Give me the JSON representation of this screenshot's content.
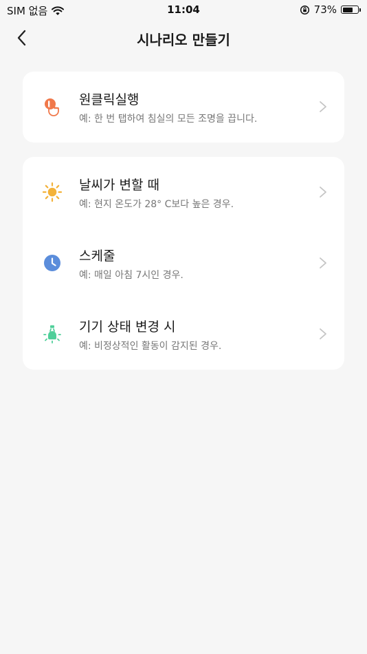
{
  "status_bar": {
    "carrier": "SIM 없음",
    "time": "11:04",
    "battery_percent": "73%",
    "battery_level": 0.73
  },
  "header": {
    "title": "시나리오 만들기",
    "back_icon": "chevron-left-icon"
  },
  "sections": [
    {
      "items": [
        {
          "title": "원클릭실행",
          "description": "예: 한 번 탭하여 침실의 모든 조명을 끕니다.",
          "icon": "tap-hand-icon",
          "icon_color": "#f0784a"
        }
      ]
    },
    {
      "items": [
        {
          "title": "날씨가 변할 때",
          "description": "예: 현지 온도가 28° C보다 높은 경우.",
          "icon": "sun-icon",
          "icon_color": "#f3b23a"
        },
        {
          "title": "스케줄",
          "description": "예: 매일 아침 7시인 경우.",
          "icon": "clock-icon",
          "icon_color": "#5b8ddb"
        },
        {
          "title": "기기 상태 변경 시",
          "description": "예: 비정상적인 활동이 감지된 경우.",
          "icon": "device-bulb-icon",
          "icon_color": "#4fcf9a"
        }
      ]
    }
  ],
  "chevron_color": "#c4c4c4"
}
